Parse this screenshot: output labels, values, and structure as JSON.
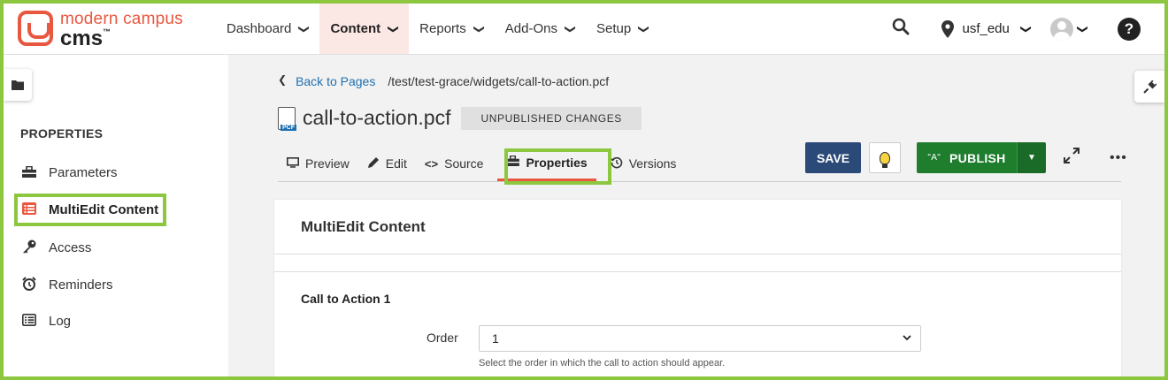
{
  "header": {
    "logo_line1": "modern campus",
    "logo_line2": "cms",
    "logo_tm": "™",
    "nav": [
      {
        "label": "Dashboard"
      },
      {
        "label": "Content"
      },
      {
        "label": "Reports"
      },
      {
        "label": "Add-Ons"
      },
      {
        "label": "Setup"
      }
    ],
    "account": "usf_edu",
    "help": "?"
  },
  "sidebar": {
    "title": "PROPERTIES",
    "items": [
      {
        "label": "Parameters",
        "icon": "toolbox-icon"
      },
      {
        "label": "MultiEdit Content",
        "icon": "list-icon"
      },
      {
        "label": "Access",
        "icon": "key-icon"
      },
      {
        "label": "Reminders",
        "icon": "alarm-clock-icon"
      },
      {
        "label": "Log",
        "icon": "list-alt-icon"
      }
    ]
  },
  "page": {
    "back_label": "Back to Pages",
    "path": "/test/test-grace/widgets/call-to-action.pcf",
    "file_badge": "PCF",
    "title": "call-to-action.pcf",
    "status": "UNPUBLISHED CHANGES"
  },
  "tabs": [
    {
      "label": "Preview"
    },
    {
      "label": "Edit"
    },
    {
      "label": "Source"
    },
    {
      "label": "Properties"
    },
    {
      "label": "Versions"
    }
  ],
  "actions": {
    "save": "SAVE",
    "publish": "PUBLISH"
  },
  "card": {
    "title": "MultiEdit Content",
    "section_title": "Call to Action 1",
    "order_label": "Order",
    "order_value": "1",
    "order_help": "Select the order in which the call to action should appear."
  },
  "colors": {
    "brand": "#e8573f",
    "highlight": "#8dc63f",
    "save": "#2c4a78",
    "publish": "#1f7d2e",
    "link": "#1e6fb0"
  }
}
